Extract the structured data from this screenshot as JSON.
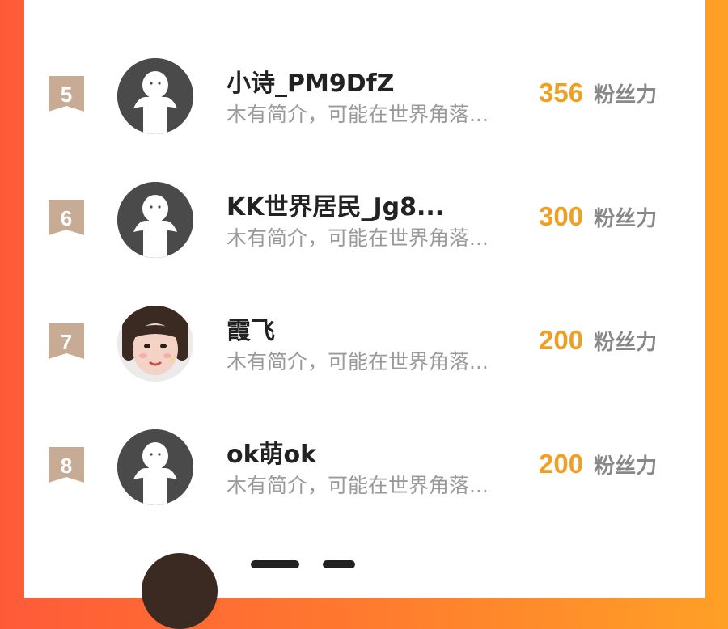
{
  "colors": {
    "background_left": "#ff5a38",
    "background_right": "#ffa026",
    "card": "#ffffff",
    "rank_badge": "#c8ab94",
    "score": "#f0a020",
    "name": "#222222",
    "bio": "#9a9a9a"
  },
  "ranking": {
    "rows": [
      {
        "rank": "5",
        "name": "小诗_PM9DfZ",
        "bio": "木有简介，可能在世界角落...",
        "score": "356",
        "unit": "粉丝力",
        "avatar": "default-person-icon"
      },
      {
        "rank": "6",
        "name": "KK世界居民_Jg8...",
        "bio": "木有简介，可能在世界角落...",
        "score": "300",
        "unit": "粉丝力",
        "avatar": "default-person-icon"
      },
      {
        "rank": "7",
        "name": "霞飞",
        "bio": "木有简介，可能在世界角落...",
        "score": "200",
        "unit": "粉丝力",
        "avatar": "child-photo"
      },
      {
        "rank": "8",
        "name": "ok萌ok",
        "bio": "木有简介，可能在世界角落...",
        "score": "200",
        "unit": "粉丝力",
        "avatar": "default-person-icon"
      }
    ]
  }
}
